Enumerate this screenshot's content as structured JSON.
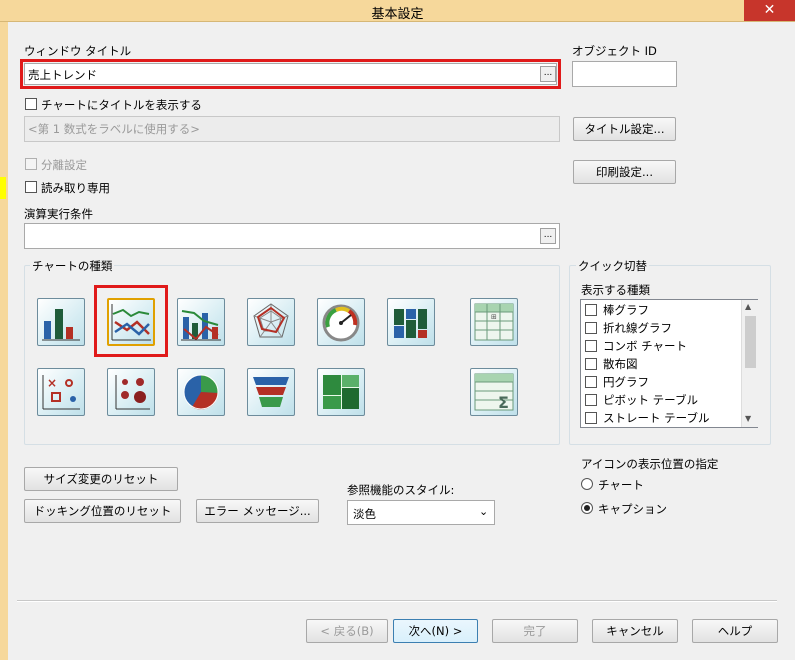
{
  "window": {
    "title": "基本設定",
    "close_glyph": "✕"
  },
  "window_title_field": {
    "label": "ウィンドウ タイトル",
    "value": "売上トレンド",
    "browse": "..."
  },
  "object_id": {
    "label": "オブジェクト ID",
    "value": ""
  },
  "show_chart_title": {
    "label": "チャートにタイトルを表示する",
    "checked": false
  },
  "title_placeholder_field": {
    "value": "<第 1 数式をラベルに使用する>"
  },
  "title_settings_button": "タイトル設定...",
  "print_settings_button": "印刷設定...",
  "separate_setting": {
    "label": "分離設定",
    "checked": false,
    "disabled": true
  },
  "read_only": {
    "label": "読み取り専用",
    "checked": false
  },
  "calc_condition": {
    "label": "演算実行条件",
    "value": "",
    "browse": "..."
  },
  "chart_types": {
    "label": "チャートの種類",
    "selected": "line-chart",
    "icons": [
      "bar-chart",
      "line-chart",
      "combo-chart",
      "radar-chart",
      "gauge-chart",
      "mekko-chart",
      "pivot-table",
      "scatter-chart",
      "grid-chart",
      "pie-chart",
      "funnel-chart",
      "block-chart",
      "straight-table"
    ]
  },
  "quick_switch": {
    "label": "クイック切替",
    "types_label": "表示する種類",
    "items": [
      "棒グラフ",
      "折れ線グラフ",
      "コンボ チャート",
      "散布図",
      "円グラフ",
      "ピボット テーブル",
      "ストレート テーブル"
    ]
  },
  "icon_position": {
    "label": "アイコンの表示位置の指定",
    "options": [
      "チャート",
      "キャプション"
    ],
    "selected": "キャプション"
  },
  "buttons": {
    "reset_size": "サイズ変更のリセット",
    "reset_docking": "ドッキング位置のリセット",
    "error_message": "エラー メッセージ..."
  },
  "ref_style": {
    "label": "参照機能のスタイル:",
    "value": "淡色"
  },
  "footer": {
    "back": "< 戻る(B)",
    "next": "次へ(N) >",
    "finish": "完了",
    "cancel": "キャンセル",
    "help": "ヘルプ"
  }
}
